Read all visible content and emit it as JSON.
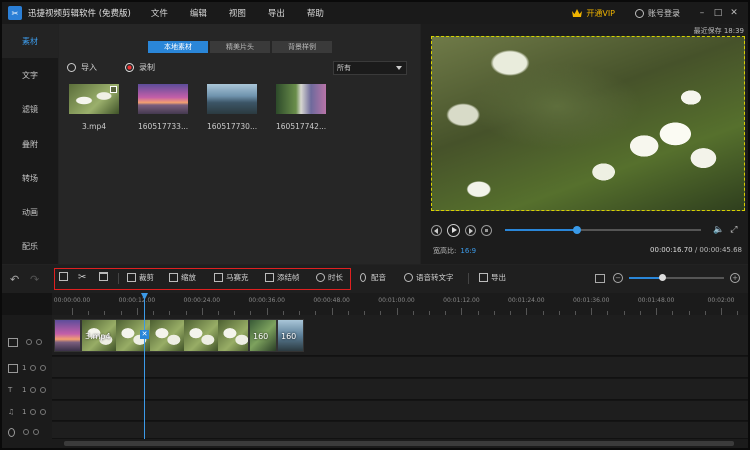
{
  "app": {
    "title": "迅捷视频剪辑软件 (免费版)",
    "menu": [
      "文件",
      "编辑",
      "视图",
      "导出",
      "帮助"
    ],
    "vip_label": "开通VIP",
    "login_label": "账号登录",
    "last_save": "最近保存 18:39"
  },
  "left_nav": {
    "items": [
      {
        "label": "素材",
        "active": true
      },
      {
        "label": "文字",
        "active": false
      },
      {
        "label": "滤镜",
        "active": false
      },
      {
        "label": "叠附",
        "active": false
      },
      {
        "label": "转场",
        "active": false
      },
      {
        "label": "动画",
        "active": false
      },
      {
        "label": "配乐",
        "active": false
      }
    ]
  },
  "media": {
    "tabs": [
      {
        "label": "本地素材",
        "active": true
      },
      {
        "label": "精美片头",
        "active": false
      },
      {
        "label": "背景样例",
        "active": false
      }
    ],
    "import_label": "导入",
    "record_label": "录制",
    "filter_value": "所有",
    "items": [
      {
        "label": "3.mp4"
      },
      {
        "label": "160517733..."
      },
      {
        "label": "160517730..."
      },
      {
        "label": "160517742..."
      }
    ]
  },
  "preview": {
    "aspect_label": "宽高比:",
    "aspect_value": "16:9",
    "current_time": "00:00:16.70",
    "total_time": "00:00:45.68",
    "progress": 0.365,
    "accent_color": "#2a86d8"
  },
  "toolbar": {
    "crop_label": "裁剪",
    "zoom_label": "缩放",
    "mosaic_label": "马赛克",
    "freeze_label": "添结帧",
    "duration_label": "时长",
    "dub_label": "配音",
    "speech_label": "语音转文字",
    "export_label": "导出",
    "zoom_level": 0.35
  },
  "timeline": {
    "ticks": [
      "00:00:00.00",
      "00:00:12.00",
      "00:00:24.00",
      "00:00:36.00",
      "00:00:48.00",
      "00:01:00.00",
      "00:01:12.00",
      "00:01:24.00",
      "00:01:36.00",
      "00:01:48.00",
      "00:02:00"
    ],
    "clips": [
      {
        "label": "3.mp4"
      },
      {
        "label": "160"
      },
      {
        "label": "160"
      }
    ],
    "track_counts": [
      "1",
      "1",
      "1"
    ]
  }
}
